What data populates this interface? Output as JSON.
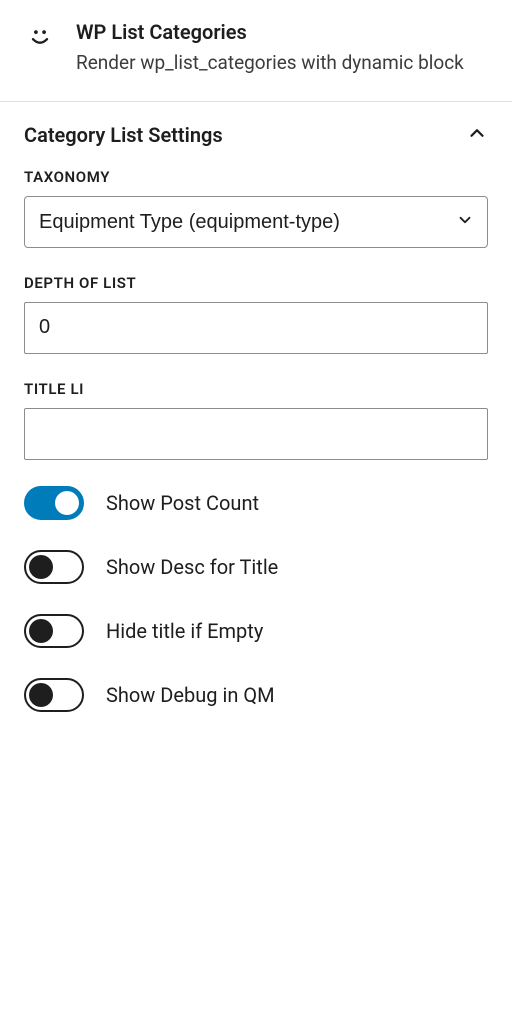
{
  "header": {
    "title": "WP List Categories",
    "description": "Render wp_list_categories with dynamic block"
  },
  "panel": {
    "title": "Category List Settings"
  },
  "fields": {
    "taxonomy": {
      "label": "TAXONOMY",
      "value": "Equipment Type (equipment-type)"
    },
    "depth": {
      "label": "DEPTH OF LIST",
      "value": "0"
    },
    "titleLi": {
      "label": "TITLE LI",
      "value": ""
    }
  },
  "toggles": {
    "showPostCount": {
      "label": "Show Post Count",
      "on": true
    },
    "showDescForTitle": {
      "label": "Show Desc for Title",
      "on": false
    },
    "hideTitleIfEmpty": {
      "label": "Hide title if Empty",
      "on": false
    },
    "showDebugInQM": {
      "label": "Show Debug in QM",
      "on": false
    }
  }
}
